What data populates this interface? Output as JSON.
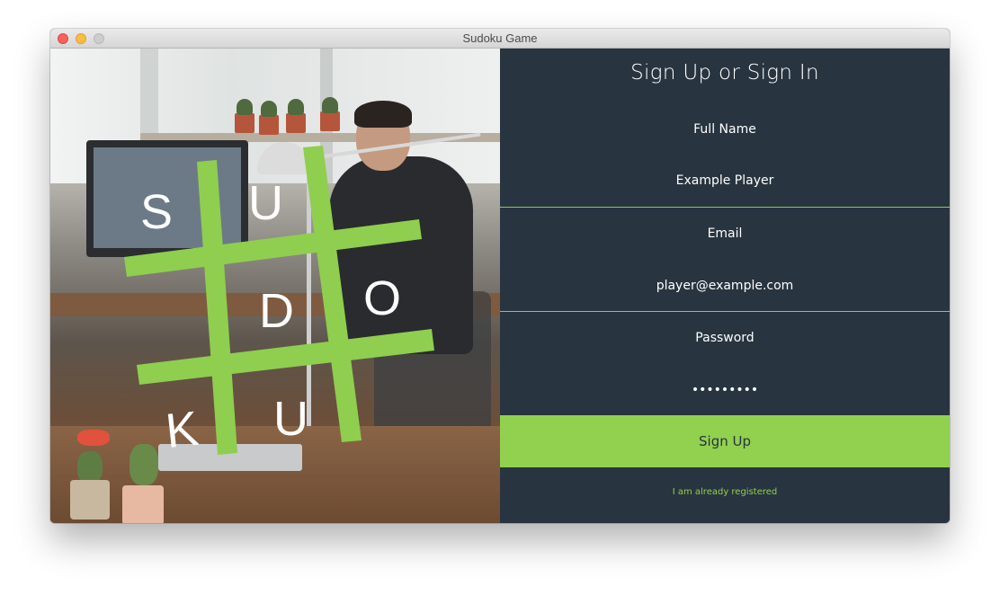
{
  "window": {
    "title": "Sudoku Game"
  },
  "logo": {
    "letters": [
      "S",
      "U",
      "D",
      "O",
      "K",
      "U"
    ],
    "grid_color": "#8fce4f"
  },
  "form": {
    "title": "Sign Up or Sign In",
    "full_name": {
      "label": "Full Name",
      "value": "Example Player"
    },
    "email": {
      "label": "Email",
      "value": "player@example.com"
    },
    "password": {
      "label": "Password",
      "value": "•••••••••"
    },
    "submit_label": "Sign Up",
    "registered_link": "I am already registered"
  },
  "colors": {
    "panel_bg": "#28343f",
    "accent": "#92d050",
    "text": "#ffffff"
  }
}
